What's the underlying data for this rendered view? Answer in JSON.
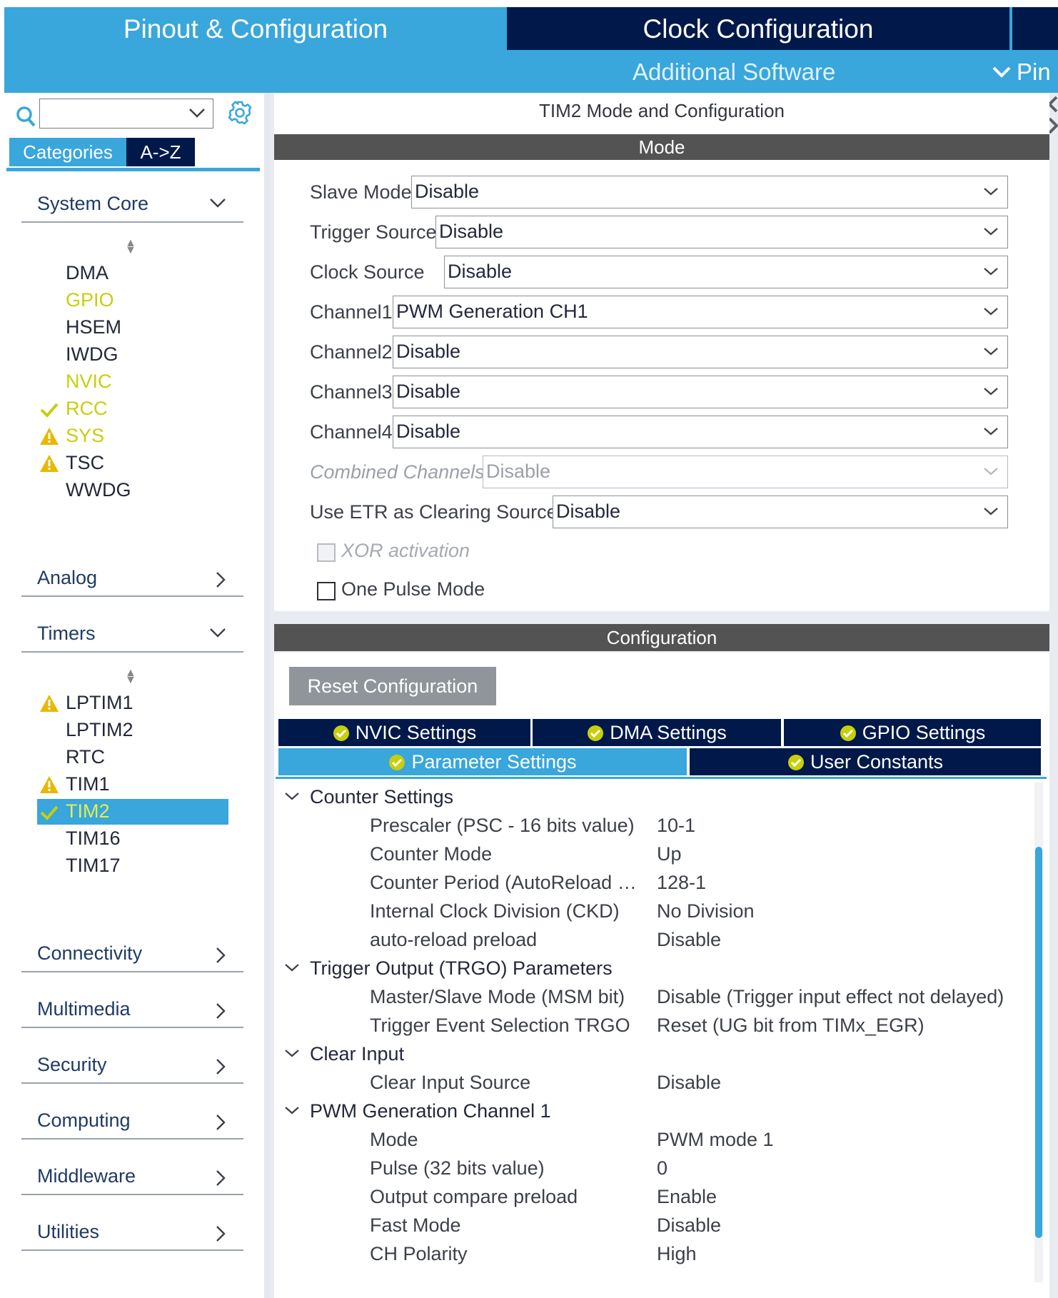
{
  "tabs": {
    "pinout": "Pinout & Configuration",
    "clock": "Clock Configuration",
    "additional": "Additional Software",
    "pin_menu": "Pin"
  },
  "sidebar": {
    "search_value": "",
    "categories_tab": "Categories",
    "az_tab": "A->Z",
    "system_core": {
      "label": "System Core",
      "items": [
        {
          "label": "DMA",
          "state": "none"
        },
        {
          "label": "GPIO",
          "state": "configured"
        },
        {
          "label": "HSEM",
          "state": "none"
        },
        {
          "label": "IWDG",
          "state": "none"
        },
        {
          "label": "NVIC",
          "state": "configured"
        },
        {
          "label": "RCC",
          "state": "ok"
        },
        {
          "label": "SYS",
          "state": "warning"
        },
        {
          "label": "TSC",
          "state": "warning"
        },
        {
          "label": "WWDG",
          "state": "none"
        }
      ]
    },
    "analog": "Analog",
    "timers": {
      "label": "Timers",
      "items": [
        {
          "label": "LPTIM1",
          "state": "warning"
        },
        {
          "label": "LPTIM2",
          "state": "none"
        },
        {
          "label": "RTC",
          "state": "none"
        },
        {
          "label": "TIM1",
          "state": "warning"
        },
        {
          "label": "TIM2",
          "state": "ok-selected"
        },
        {
          "label": "TIM16",
          "state": "none"
        },
        {
          "label": "TIM17",
          "state": "none"
        }
      ]
    },
    "connectivity": "Connectivity",
    "multimedia": "Multimedia",
    "security": "Security",
    "computing": "Computing",
    "middleware": "Middleware",
    "utilities": "Utilities"
  },
  "mode": {
    "title": "TIM2 Mode and Configuration",
    "header": "Mode",
    "fields": [
      {
        "label": "Slave Mode",
        "value": "Disable"
      },
      {
        "label": "Trigger Source",
        "value": "Disable"
      },
      {
        "label": "Clock Source",
        "value": "Disable"
      },
      {
        "label": "Channel1",
        "value": "PWM Generation CH1"
      },
      {
        "label": "Channel2",
        "value": "Disable"
      },
      {
        "label": "Channel3",
        "value": "Disable"
      },
      {
        "label": "Channel4",
        "value": "Disable"
      },
      {
        "label": "Combined Channels",
        "value": "Disable"
      },
      {
        "label": "Use ETR as Clearing Source",
        "value": "Disable"
      }
    ],
    "xor_label": "XOR activation",
    "one_pulse_label": "One Pulse Mode"
  },
  "config": {
    "header": "Configuration",
    "reset_label": "Reset Configuration",
    "tabs": {
      "nvic": "NVIC Settings",
      "dma": "DMA Settings",
      "gpio": "GPIO Settings",
      "parameter": "Parameter Settings",
      "user": "User Constants"
    },
    "groups": [
      {
        "label": "Counter Settings",
        "params": [
          {
            "label": "Prescaler (PSC - 16 bits value)",
            "value": "10-1"
          },
          {
            "label": "Counter Mode",
            "value": "Up"
          },
          {
            "label": "Counter Period (AutoReload Re...",
            "value": "128-1"
          },
          {
            "label": "Internal Clock Division (CKD)",
            "value": "No Division"
          },
          {
            "label": "auto-reload preload",
            "value": "Disable"
          }
        ]
      },
      {
        "label": "Trigger Output (TRGO) Parameters",
        "params": [
          {
            "label": "Master/Slave Mode (MSM bit)",
            "value": "Disable (Trigger input effect not delayed)"
          },
          {
            "label": "Trigger Event Selection TRGO",
            "value": "Reset (UG bit from TIMx_EGR)"
          }
        ]
      },
      {
        "label": "Clear Input",
        "params": [
          {
            "label": "Clear Input Source",
            "value": "Disable"
          }
        ]
      },
      {
        "label": "PWM Generation Channel 1",
        "params": [
          {
            "label": "Mode",
            "value": "PWM mode 1"
          },
          {
            "label": "Pulse (32 bits value)",
            "value": "0"
          },
          {
            "label": "Output compare preload",
            "value": "Enable"
          },
          {
            "label": "Fast Mode",
            "value": "Disable"
          },
          {
            "label": "CH Polarity",
            "value": "High"
          }
        ]
      }
    ]
  },
  "colors": {
    "accent": "#39a6dc",
    "navy": "#00194a",
    "configured": "#c7cf0a",
    "warning": "#e8b800"
  }
}
